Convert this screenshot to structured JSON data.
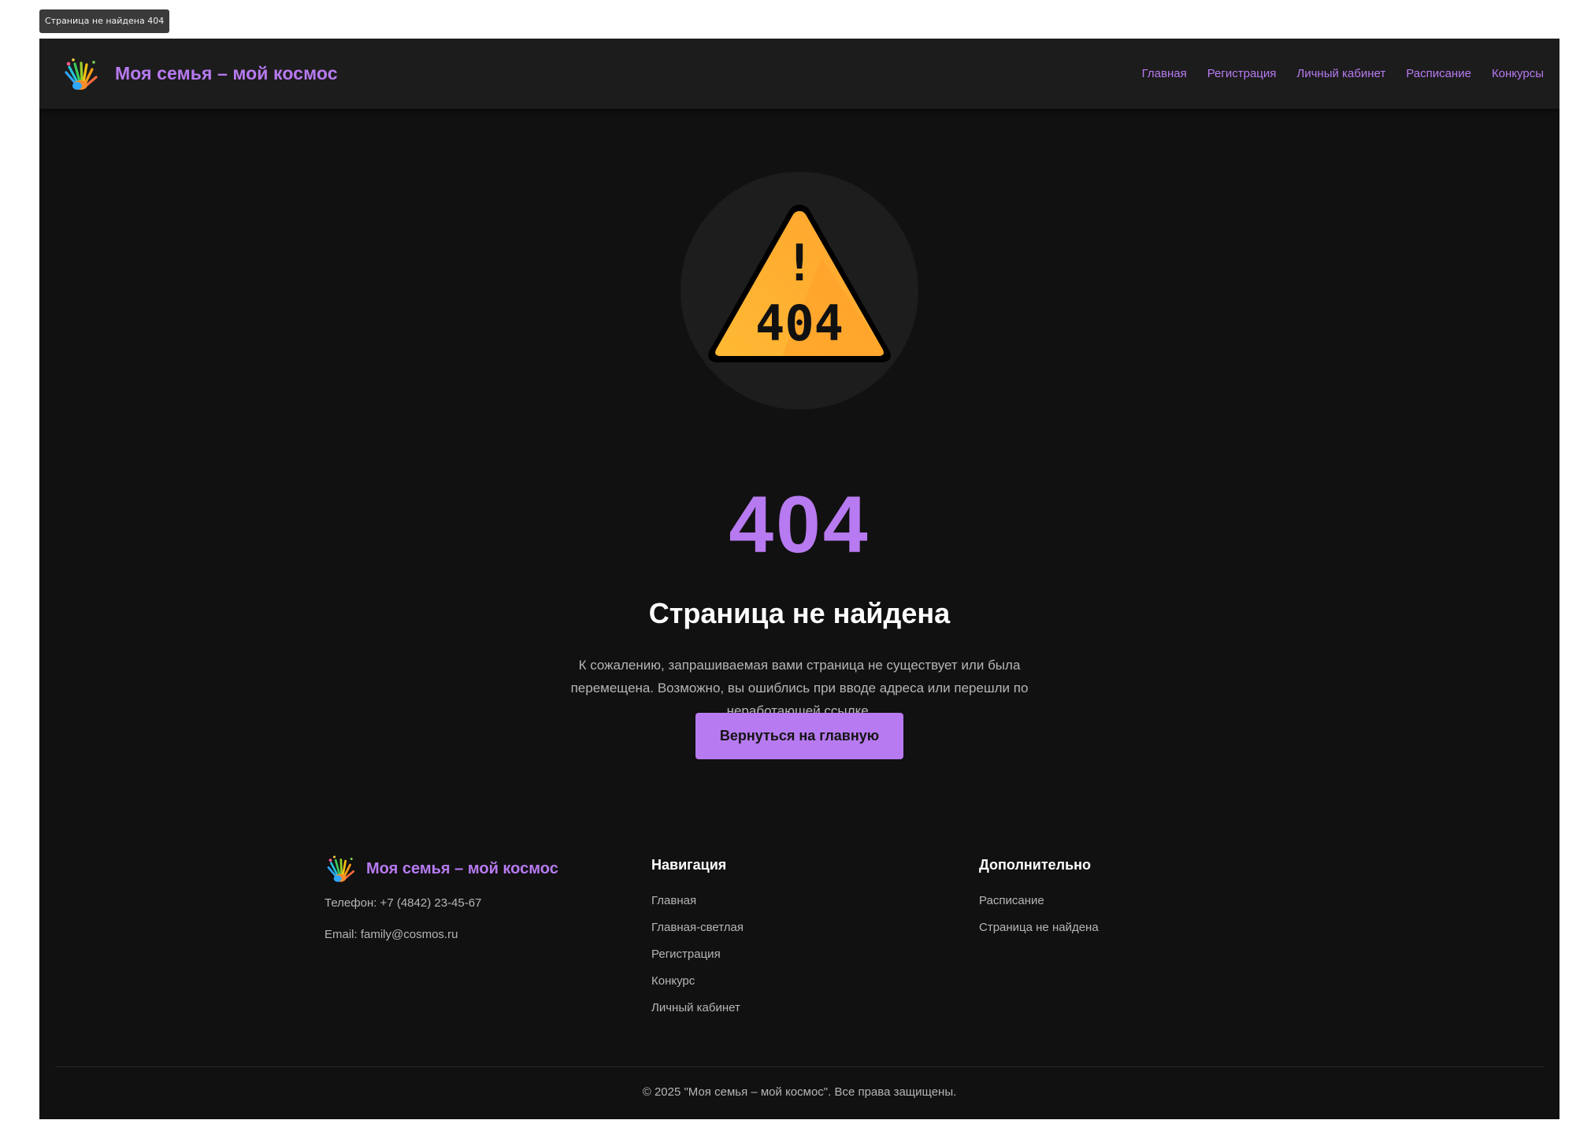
{
  "tooltip": "Страница не найдена 404",
  "header": {
    "brand_title": "Моя семья – мой космос",
    "nav": [
      "Главная",
      "Регистрация",
      "Личный кабинет",
      "Расписание",
      "Конкурсы"
    ]
  },
  "hero": {
    "icon_text": "404",
    "icon_mark": "!",
    "code": "404",
    "title": "Страница не найдена",
    "description": "К сожалению, запрашиваемая вами страница не существует или была перемещена. Возможно, вы ошиблись при вводе адреса или перешли по неработающей ссылке.",
    "button": "Вернуться на главную"
  },
  "footer": {
    "brand_title": "Моя семья – мой космос",
    "phone": "Телефон: +7 (4842) 23-45-67",
    "email": "Email: family@cosmos.ru",
    "nav_title": "Навигация",
    "nav_links": [
      "Главная",
      "Главная-светлая",
      "Регистрация",
      "Конкурс",
      "Личный кабинет"
    ],
    "extra_title": "Дополнительно",
    "extra_links": [
      "Расписание",
      "Страница не найдена"
    ],
    "copyright": "© 2025 \"Моя семья – мой космос\". Все права защищены."
  },
  "colors": {
    "accent": "#b77af0",
    "background": "#111111",
    "header_bg": "#1c1c1c",
    "warning": "#ffb933"
  },
  "icons": [
    "hands-logo-icon",
    "warning-404-icon"
  ]
}
